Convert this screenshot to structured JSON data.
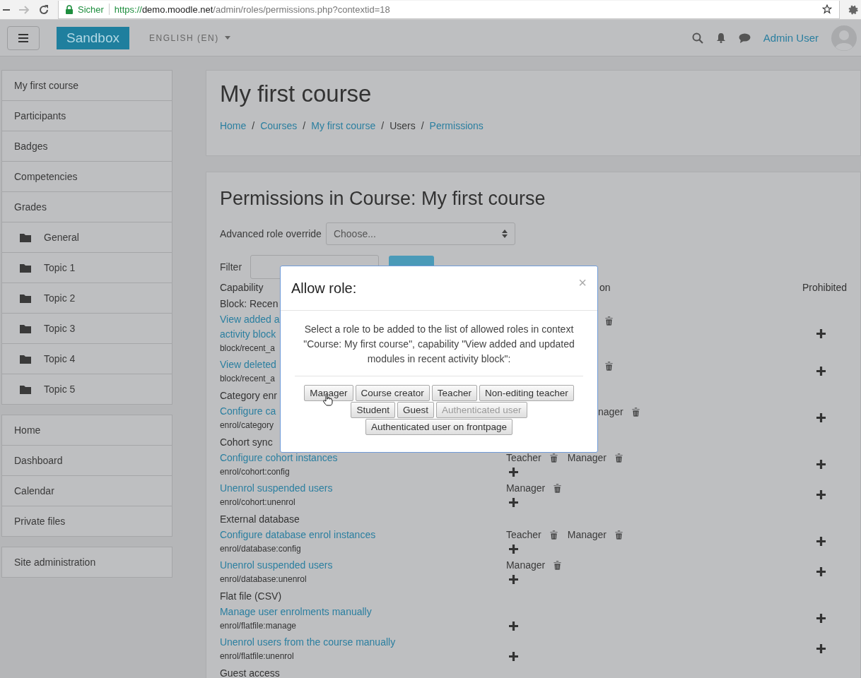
{
  "browser": {
    "secure_label": "Sicher",
    "url_scheme": "https://",
    "url_host": "demo.moodle.net",
    "url_path": "/admin/roles/permissions.php?contextid=18"
  },
  "navbar": {
    "brand": "Sandbox",
    "language": "ENGLISH (EN)",
    "user": "Admin User"
  },
  "sidebar": {
    "blocks": [
      {
        "items": [
          {
            "label": "My first course",
            "kind": "link"
          },
          {
            "label": "Participants",
            "kind": "link"
          },
          {
            "label": "Badges",
            "kind": "link"
          },
          {
            "label": "Competencies",
            "kind": "link"
          },
          {
            "label": "Grades",
            "kind": "link"
          },
          {
            "label": "General",
            "kind": "section"
          },
          {
            "label": "Topic 1",
            "kind": "section"
          },
          {
            "label": "Topic 2",
            "kind": "section"
          },
          {
            "label": "Topic 3",
            "kind": "section"
          },
          {
            "label": "Topic 4",
            "kind": "section"
          },
          {
            "label": "Topic 5",
            "kind": "section"
          }
        ]
      },
      {
        "items": [
          {
            "label": "Home",
            "kind": "link"
          },
          {
            "label": "Dashboard",
            "kind": "link"
          },
          {
            "label": "Calendar",
            "kind": "link"
          },
          {
            "label": "Private files",
            "kind": "link"
          }
        ]
      },
      {
        "items": [
          {
            "label": "Site administration",
            "kind": "link"
          }
        ]
      }
    ]
  },
  "header": {
    "title": "My first course",
    "breadcrumb": [
      {
        "label": "Home",
        "link": true
      },
      {
        "label": "Courses",
        "link": true
      },
      {
        "label": "My first course",
        "link": true
      },
      {
        "label": "Users",
        "link": false
      },
      {
        "label": "Permissions",
        "link": true
      }
    ],
    "separator": "/"
  },
  "permissions": {
    "title": "Permissions in Course: My first course",
    "override_label": "Advanced role override",
    "override_value": "Choose...",
    "filter_label": "Filter",
    "columns": {
      "capability": "Capability",
      "column_2": "on",
      "prohibited": "Prohibited"
    },
    "rows": [
      {
        "kind": "group",
        "label": "Block: Recen"
      },
      {
        "kind": "capability",
        "name_lines": [
          "View added a",
          "activity block"
        ],
        "code": "block/recent_a",
        "allowed": [
          {
            "kind": "trash"
          }
        ],
        "add": false
      },
      {
        "kind": "capability",
        "name_lines": [
          "View deleted"
        ],
        "code": "block/recent_a",
        "allowed": [
          {
            "kind": "trash"
          }
        ],
        "add": false
      },
      {
        "kind": "group",
        "label": "Category enr"
      },
      {
        "kind": "capability",
        "name_lines": [
          "Configure ca"
        ],
        "code": "enrol/category",
        "allowed": [
          {
            "kind": "partial",
            "role": "nager"
          }
        ],
        "add": false
      },
      {
        "kind": "group",
        "label": "Cohort sync"
      },
      {
        "kind": "capability",
        "name_lines": [
          "Configure cohort instances"
        ],
        "code": "enrol/cohort:config",
        "allowed": [
          {
            "kind": "role",
            "role": "Teacher"
          },
          {
            "kind": "role",
            "role": "Manager"
          }
        ],
        "add": true
      },
      {
        "kind": "capability",
        "name_lines": [
          "Unenrol suspended users"
        ],
        "code": "enrol/cohort:unenrol",
        "allowed": [
          {
            "kind": "role",
            "role": "Manager"
          }
        ],
        "add": true
      },
      {
        "kind": "group",
        "label": "External database"
      },
      {
        "kind": "capability",
        "name_lines": [
          "Configure database enrol instances"
        ],
        "code": "enrol/database:config",
        "allowed": [
          {
            "kind": "role",
            "role": "Teacher"
          },
          {
            "kind": "role",
            "role": "Manager"
          }
        ],
        "add": true
      },
      {
        "kind": "capability",
        "name_lines": [
          "Unenrol suspended users"
        ],
        "code": "enrol/database:unenrol",
        "allowed": [
          {
            "kind": "role",
            "role": "Manager"
          }
        ],
        "add": true
      },
      {
        "kind": "group",
        "label": "Flat file (CSV)"
      },
      {
        "kind": "capability",
        "name_lines": [
          "Manage user enrolments manually"
        ],
        "code": "enrol/flatfile:manage",
        "allowed": [],
        "add": true
      },
      {
        "kind": "capability",
        "name_lines": [
          "Unenrol users from the course manually"
        ],
        "code": "enrol/flatfile:unenrol",
        "allowed": [],
        "add": true
      },
      {
        "kind": "group",
        "label": "Guest access"
      }
    ]
  },
  "dialog": {
    "title": "Allow role:",
    "close": "×",
    "message": "Select a role to be added to the list of allowed roles in context \"Course: My first course\", capability \"View added and updated modules in recent activity block\":",
    "roles": [
      {
        "label": "Manager",
        "disabled": false
      },
      {
        "label": "Course creator",
        "disabled": false
      },
      {
        "label": "Teacher",
        "disabled": false
      },
      {
        "label": "Non-editing teacher",
        "disabled": false
      },
      {
        "label": "Student",
        "disabled": false
      },
      {
        "label": "Guest",
        "disabled": false
      },
      {
        "label": "Authenticated user",
        "disabled": true
      },
      {
        "label": "Authenticated user on frontpage",
        "disabled": false
      }
    ]
  }
}
